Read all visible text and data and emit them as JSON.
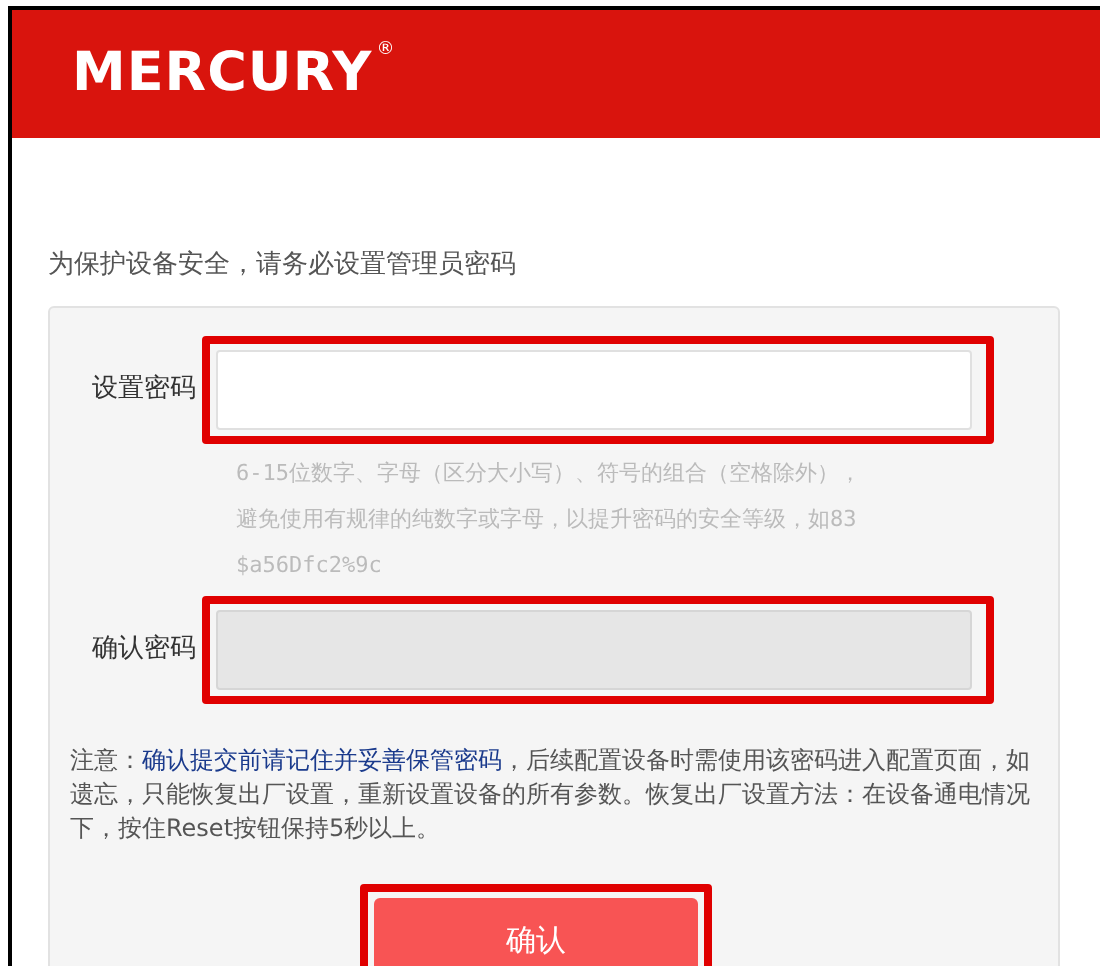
{
  "header": {
    "logo": "MERCURY",
    "logo_mark": "®"
  },
  "intro": "为保护设备安全，请务必设置管理员密码",
  "fields": [
    {
      "label": "设置密码",
      "disabled": false,
      "highlighted": true,
      "hint": [
        "6-15位数字、字母（区分大小写）、符号的组合（空格除外），",
        "避免使用有规律的纯数字或字母，以提升密码的安全等级，如83",
        "$a56Dfc2%9c"
      ]
    },
    {
      "label": "确认密码",
      "disabled": true,
      "highlighted": true
    }
  ],
  "note": {
    "prefix": "注意：",
    "emphasis": "确认提交前请记住并妥善保管密码",
    "rest": "，后续配置设备时需使用该密码进入配置页面，如遗忘，只能恢复出厂设置，重新设置设备的所有参数。恢复出厂设置方法：在设备通电情况下，按住Reset按钮保持5秒以上。"
  },
  "button": {
    "label": "确认",
    "highlighted": true
  }
}
